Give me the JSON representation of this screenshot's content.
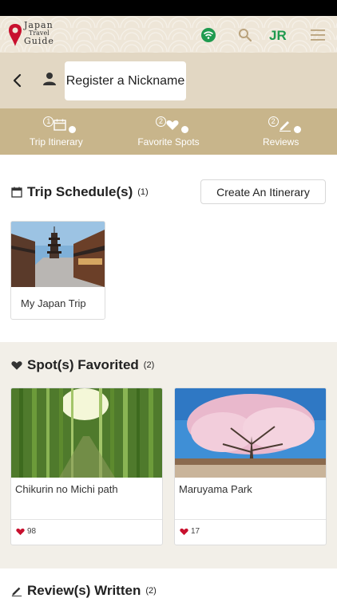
{
  "app": {
    "logo_line1": "Japan",
    "logo_line2": "Travel",
    "logo_line3": "Guide",
    "icons": [
      "wifi-icon",
      "search-icon",
      "jr-logo-icon",
      "menu-icon"
    ],
    "jr_text": "JR"
  },
  "header": {
    "nickname_button": "Register a Nickname"
  },
  "tabs": [
    {
      "count": "1",
      "label": "Trip Itinerary",
      "icon": "calendar-icon"
    },
    {
      "count": "2",
      "label": "Favorite Spots",
      "icon": "heart-icon"
    },
    {
      "count": "2",
      "label": "Reviews",
      "icon": "pencil-icon"
    }
  ],
  "schedule": {
    "title": "Trip Schedule(s)",
    "count": "(1)",
    "create_button": "Create An Itinerary",
    "trips": [
      {
        "name": "My Japan Trip"
      }
    ]
  },
  "favorites": {
    "title": "Spot(s) Favorited",
    "count": "(2)",
    "spots": [
      {
        "name": "Chikurin no Michi path",
        "likes": "98"
      },
      {
        "name": "Maruyama Park",
        "likes": "17"
      }
    ]
  },
  "reviews": {
    "title": "Review(s) Written",
    "count": "(2)"
  },
  "colors": {
    "accent_gold": "#c8b58b",
    "jr_green": "#1f9a4f",
    "heart_red": "#c8102e"
  }
}
